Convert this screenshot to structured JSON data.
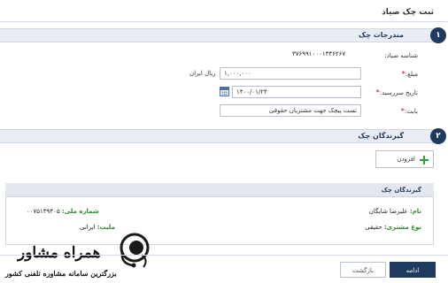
{
  "page": {
    "title": "ثبت چک صیاد"
  },
  "section1": {
    "number": "۱",
    "title": "مندرجات چک",
    "sayad_label": "شناسه صیاد:",
    "sayad_value": "۳۷۶۹۹۱۰۰۰۱۳۴۶۲۶۷",
    "amount_label": "مبلغ:",
    "amount_value": "۱,۰۰۰,۰۰۰",
    "amount_unit": "ریال ایران",
    "due_label": "تاریخ سررسید:",
    "due_value": "۱۴۰۰/۰۱/۲۴",
    "reason_label": "بابت:",
    "reason_value": "تست پیچک جهت مشتریان حقوقی",
    "required_mark": "*"
  },
  "section2": {
    "number": "۲",
    "title": "گیرندگان چک",
    "add_label": "افزودن"
  },
  "recipients": {
    "header": "گیرندگان چک",
    "name_label": "نام:",
    "name_value": "علیرضا شایگان",
    "national_label": "شماره ملی:",
    "national_value": "۰۰۷۵۱۳۹۴۰۵",
    "type_label": "نوع مشتری:",
    "type_value": "حقیقی",
    "nationality_label": "ملیت:",
    "nationality_value": "ایرانی"
  },
  "footer": {
    "continue_label": "ادامه",
    "back_label": "بازگشت"
  },
  "watermark": {
    "brand": "همراه مشاور",
    "tagline": "بزرگترین سامانه مشاوره تلفنی کشور"
  },
  "colors": {
    "navy": "#1f3a5f",
    "green": "#2c8a2c",
    "required": "#d0021b"
  }
}
